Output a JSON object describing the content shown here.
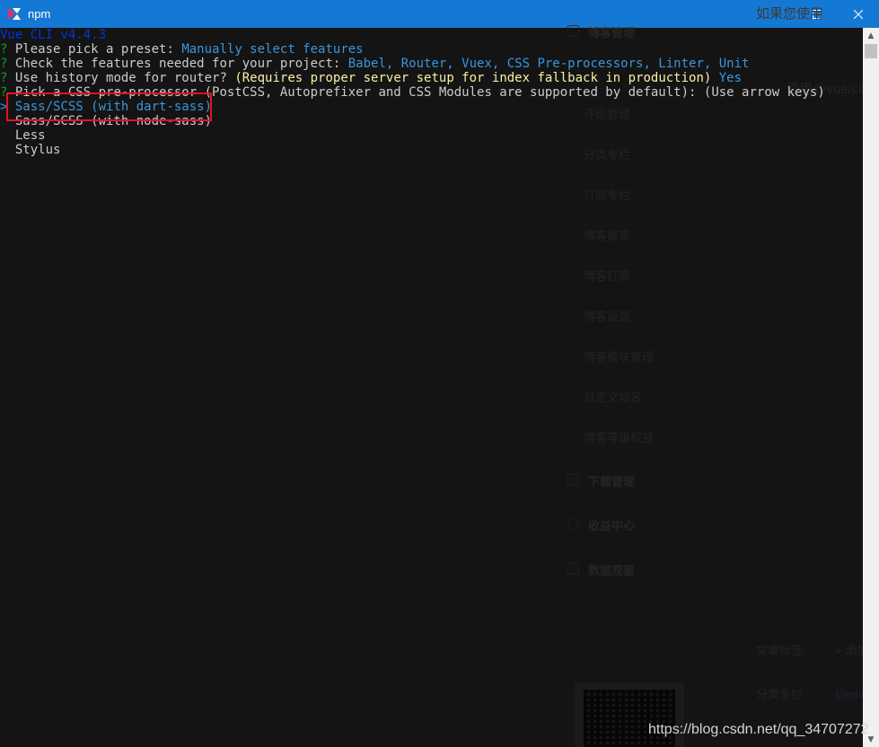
{
  "window": {
    "title": "npm"
  },
  "background": {
    "top_text": "如果您使用",
    "right_text": "使用@vue/cli,",
    "menu_blog": "博客管理",
    "menu_items": [
      "评论管理",
      "分类专栏",
      "订阅专栏",
      "博客搬家",
      "博客打赏",
      "博客设置",
      "博客模块管理",
      "自定义域名",
      "博客等级权益"
    ],
    "menu_download": "下载管理",
    "menu_income": "收益中心",
    "menu_data": "数据观星",
    "tags_label": "文章标签:",
    "tags_add": "+ 添加",
    "category_label": "分类专栏:",
    "category_value": "Element"
  },
  "terminal": {
    "line1": "Vue CLI v4.4.3",
    "line2": {
      "q": "?",
      "label": " Please pick a preset: ",
      "answer": "Manually select features"
    },
    "line3": {
      "q": "?",
      "label": " Check the features needed for your project: ",
      "answer": "Babel, Router, Vuex, CSS Pre-processors, Linter, Unit"
    },
    "line4": {
      "q": "?",
      "label": " Use history mode for router? ",
      "hint": "(Requires proper server setup for index fallback in production)",
      "answer": " Yes"
    },
    "line5": {
      "q": "?",
      "label": " Pick a CSS pre-processor (PostCSS, Autoprefixer and CSS Modules are supported by default): ",
      "hint": "(Use arrow keys)"
    },
    "pointer": ">",
    "options": [
      "Sass/SCSS (with dart-sass)",
      "Sass/SCSS (with node-sass)",
      "Less",
      "Stylus"
    ]
  },
  "watermark": "https://blog.csdn.net/qq_34707272",
  "colors": {
    "titlebar": "#1479d4",
    "highlight_box": "#e81123",
    "selected_option": "#3a96dd"
  }
}
